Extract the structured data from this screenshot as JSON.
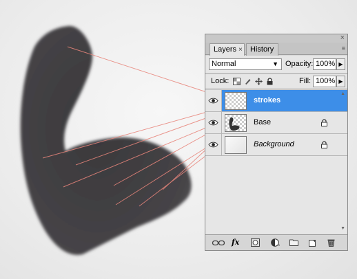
{
  "panel": {
    "close_glyph": "×",
    "tabs": [
      {
        "label": "Layers",
        "close": "×"
      },
      {
        "label": "History"
      }
    ],
    "menu_glyph": "≡",
    "blend_mode": "Normal",
    "opacity_label": "Opacity:",
    "opacity_value": "100%",
    "lock_label": "Lock:",
    "fill_label": "Fill:",
    "fill_value": "100%",
    "icons": {
      "visibility": "eye-icon",
      "lock": "lock-icon",
      "link": "link-layers-icon",
      "fx": "fx",
      "mask": "layer-mask-icon",
      "adjust": "adjustment-layer-icon",
      "group": "folder-icon",
      "new": "new-layer-icon",
      "delete": "trash-icon"
    },
    "layers": [
      {
        "name": "strokes",
        "selected": true,
        "thumb": "transparent"
      },
      {
        "name": "Base",
        "selected": false,
        "thumb": "shape",
        "locked": true
      },
      {
        "name": "Background",
        "selected": false,
        "thumb": "white",
        "locked": true,
        "italic": true
      }
    ]
  },
  "colors": {
    "selection": "#3d8ee8",
    "shape": "#3f3d40",
    "guide_lines": "#e8857b"
  }
}
